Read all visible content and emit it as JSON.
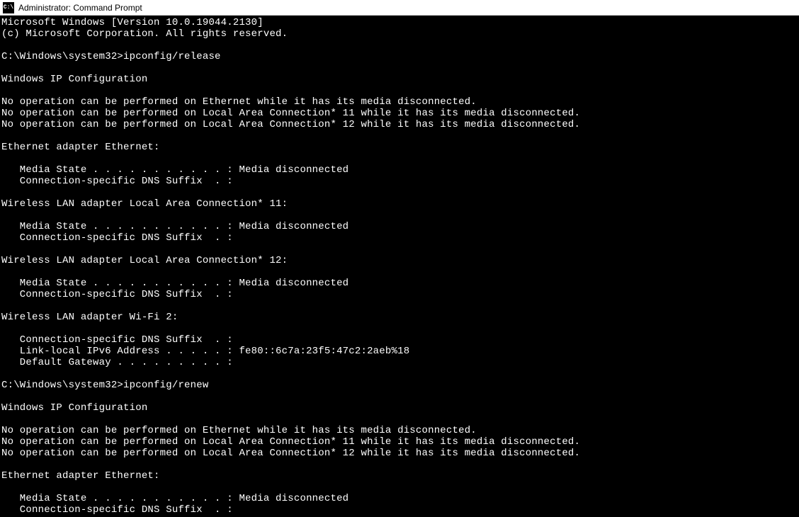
{
  "window": {
    "icon_label": "C:\\",
    "title": "Administrator: Command Prompt"
  },
  "terminal": {
    "lines": [
      "Microsoft Windows [Version 10.0.19044.2130]",
      "(c) Microsoft Corporation. All rights reserved.",
      "",
      "C:\\Windows\\system32>ipconfig/release",
      "",
      "Windows IP Configuration",
      "",
      "No operation can be performed on Ethernet while it has its media disconnected.",
      "No operation can be performed on Local Area Connection* 11 while it has its media disconnected.",
      "No operation can be performed on Local Area Connection* 12 while it has its media disconnected.",
      "",
      "Ethernet adapter Ethernet:",
      "",
      "   Media State . . . . . . . . . . . : Media disconnected",
      "   Connection-specific DNS Suffix  . :",
      "",
      "Wireless LAN adapter Local Area Connection* 11:",
      "",
      "   Media State . . . . . . . . . . . : Media disconnected",
      "   Connection-specific DNS Suffix  . :",
      "",
      "Wireless LAN adapter Local Area Connection* 12:",
      "",
      "   Media State . . . . . . . . . . . : Media disconnected",
      "   Connection-specific DNS Suffix  . :",
      "",
      "Wireless LAN adapter Wi-Fi 2:",
      "",
      "   Connection-specific DNS Suffix  . :",
      "   Link-local IPv6 Address . . . . . : fe80::6c7a:23f5:47c2:2aeb%18",
      "   Default Gateway . . . . . . . . . :",
      "",
      "C:\\Windows\\system32>ipconfig/renew",
      "",
      "Windows IP Configuration",
      "",
      "No operation can be performed on Ethernet while it has its media disconnected.",
      "No operation can be performed on Local Area Connection* 11 while it has its media disconnected.",
      "No operation can be performed on Local Area Connection* 12 while it has its media disconnected.",
      "",
      "Ethernet adapter Ethernet:",
      "",
      "   Media State . . . . . . . . . . . : Media disconnected",
      "   Connection-specific DNS Suffix  . :"
    ]
  }
}
